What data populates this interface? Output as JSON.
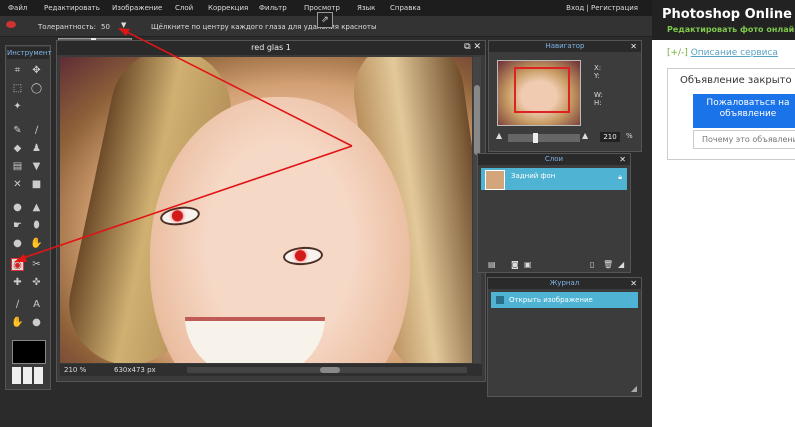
{
  "menubar": {
    "items": [
      "Файл",
      "Редактировать",
      "Изображение",
      "Слой",
      "Коррекция",
      "Фильтр",
      "Просмотр",
      "Язык",
      "Справка"
    ],
    "login": "Вход | Регистрация"
  },
  "options": {
    "tolerance_label": "Толерантность:",
    "tolerance_value": "50",
    "hint": "Щёлкните по центру каждого глаза для удаления красноты"
  },
  "toolbox": {
    "title": "Инструмент"
  },
  "document": {
    "title": "red glas 1",
    "zoom": "210 %",
    "size": "630x473 px"
  },
  "navigator": {
    "title": "Навигатор",
    "x_label": "X:",
    "y_label": "Y:",
    "w_label": "W:",
    "h_label": "H:",
    "zoom_value": "210",
    "zoom_unit": "%"
  },
  "layers": {
    "title": "Слои",
    "items": [
      "Задний фон"
    ]
  },
  "history": {
    "title": "Журнал",
    "items": [
      "Открыть изображение"
    ]
  },
  "right_panel": {
    "title": "Photoshop Online",
    "subtitle": "Редактировать фото онлайн",
    "desc_toggle": "[+/-]",
    "desc_link": "Описание сервиса",
    "ad_title": "Объявление закрыто",
    "ad_button": "Пожаловаться на объявление",
    "ad_why": "Почему это объявление?"
  },
  "colors": {
    "accent": "#4fb4d4",
    "redeye": "#d01b1b",
    "brand_green": "#7ec84d"
  }
}
